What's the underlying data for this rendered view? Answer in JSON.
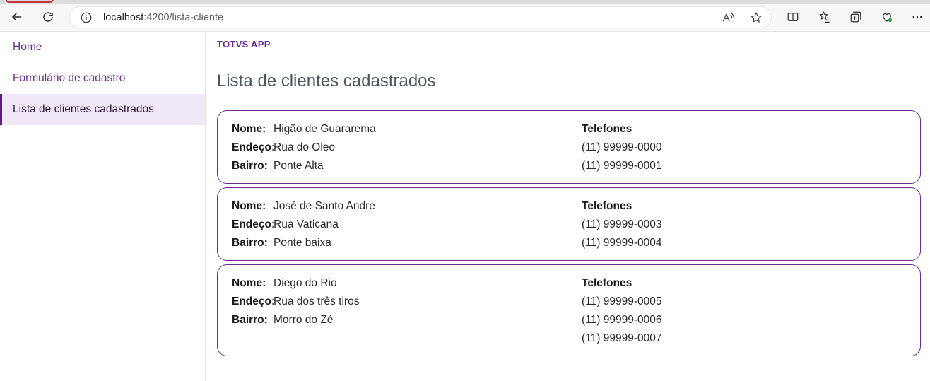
{
  "browser": {
    "url_host": "localhost",
    "url_rest": ":4200/lista-cliente"
  },
  "sidebar": {
    "items": [
      {
        "label": "Home"
      },
      {
        "label": "Formulário de cadastro"
      },
      {
        "label": "Lista de clientes cadastrados"
      }
    ]
  },
  "header": {
    "brand": "TOTVS APP",
    "title": "Lista de clientes cadastrados"
  },
  "labels": {
    "nome": "Nome:",
    "endereco": "Endeço:",
    "bairro": "Bairro:",
    "telefones": "Telefones"
  },
  "clientes": [
    {
      "nome": "Higão de Guararema",
      "endereco": "Rua do Oleo",
      "bairro": "Ponte Alta",
      "telefones": [
        "(11) 99999-0000",
        "(11) 99999-0001"
      ]
    },
    {
      "nome": "José de Santo Andre",
      "endereco": "Rua Vaticana",
      "bairro": "Ponte baixa",
      "telefones": [
        "(11) 99999-0003",
        "(11) 99999-0004"
      ]
    },
    {
      "nome": "Diego do Rio",
      "endereco": "Rua dos três tiros",
      "bairro": "Morro do Zé",
      "telefones": [
        "(11) 99999-0005",
        "(11) 99999-0006",
        "(11) 99999-0007"
      ]
    }
  ],
  "colors": {
    "accent": "#6a2c91",
    "active_bg": "#f1e8f7"
  }
}
